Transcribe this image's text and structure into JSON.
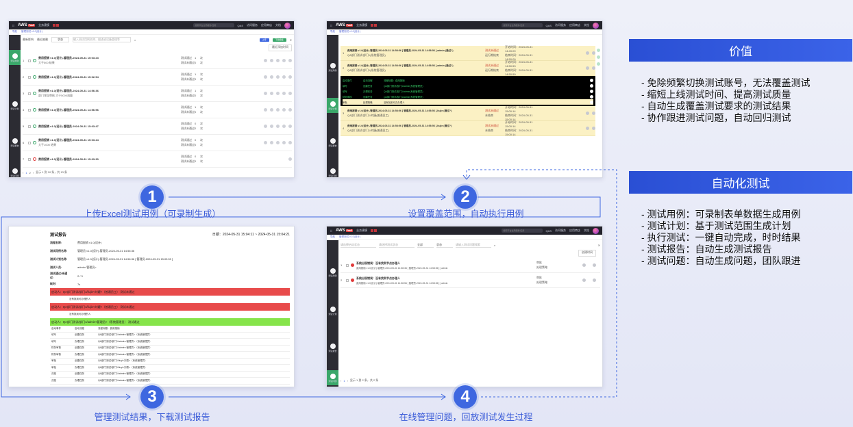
{
  "app": {
    "logo_text": "AWS",
    "logo_badge": "PaaS",
    "app_name": "业务建模",
    "nav": [
      "QAS",
      "访问服务",
      "应用商店",
      "文档"
    ],
    "search_placeholder": "搜索平台全局服务/应用"
  },
  "panel1": {
    "crumbs": [
      "导航",
      "管理测试 v1.0(设计)"
    ],
    "toolbar": {
      "checks": [
        "最新影响",
        "最近被删"
      ],
      "select": "状态",
      "search_placeholder": "输入测试用例名称、描述或设备管理等",
      "upload": "上传",
      "download": "下载模板"
    },
    "batch_label": "最近添加时间",
    "sidebar": [
      "测试用例",
      "测试计划",
      "测试报告",
      "测试问题"
    ],
    "rows": [
      {
        "n": "1",
        "title": "费用报销 v1.0(设计)-管理员-2024-05-31 15:03:23",
        "tag": "大于500 结果",
        "pass": "1",
        "fail": "0"
      },
      {
        "n": "2",
        "title": "费用报销 v1.0(设计)-管理员-2024-05-31 15:02:54",
        "tag": "",
        "pass": "1",
        "fail": "0"
      },
      {
        "n": "3",
        "title": "费用报销 v1.0(设计)-管理员-2024-05-31 14:56:36",
        "tag": "部门领导审核  大于5000流量",
        "pass": "1",
        "fail": "0"
      },
      {
        "n": "4",
        "title": "费用报销 v1.0(设计)-管理员-2024-05-31 14:56:56",
        "tag": "",
        "pass": "1",
        "fail": "0"
      },
      {
        "n": "5",
        "title": "费用报销 v1.0(设计)-管理员-2024-05-31 15:03:47",
        "tag": "",
        "pass": "0",
        "fail": "0"
      },
      {
        "n": "6",
        "title": "费用报销 v1.0(设计)-管理员-2024-05-31 15:03:44",
        "tag": "大于1000 结果",
        "pass": "0",
        "fail": "0"
      },
      {
        "n": "7",
        "title": "费用报销 v1.0(设计)-管理员-2024-05-31 15:03:30",
        "tag": "",
        "pass": "0",
        "fail": "0"
      }
    ],
    "pass_label": "测试通过",
    "fail_label": "测试未通过",
    "unit": "次",
    "pager": "显示 1 到 10 条，共 13 条"
  },
  "panel2": {
    "crumbs": [
      "导航",
      "管理测试 v1.0(设计)"
    ],
    "sidebar": [
      "测试用例",
      "测试计划",
      "测试报告",
      "测试问题"
    ],
    "rows": [
      {
        "n": "1",
        "title": "费用报销 v1.0(设计)-管理员-2024-05-31 14:58:56 [ 管理员-2024-05-31 14:58:56 ]-admin (通过?)",
        "sub": "QA部门测试/部门1(系统管理员)",
        "status1": "测试未通过",
        "status2": "运行期结束",
        "t1": "开始时间：2024-05-31 14:49:09",
        "t2": "结束时间：2024-05-31 14:50:09"
      },
      {
        "n": "2",
        "title": "费用报销 v1.0(设计)-管理员-2024-05-31 14:58:56 [ 管理员-2024-05-31 14:58:56 ]-admin (通过?)",
        "sub": "QA部门测试/部门1(系统管理员)",
        "status1": "测试未通过",
        "status2": "运行期结束",
        "t1": "开始时间：2024-05-31 14:50:53",
        "t2": "结束时间：2024-05-31 14:50:59"
      },
      {
        "n": "3",
        "title": "费用报销 v1.0(设计)-管理员-2024-05-31 14:58:56 [ 管理员-2024-05-31 14:58:56 ]-liujie (通过?)",
        "sub": "QA部门测试/部门1/刘婕(普通员工)",
        "status1": "测试未通过",
        "status2": "未结束",
        "t1": "开始时间：2024-05-31 15:00:14",
        "t2": "结束时间：2024-05-31 15:00:14"
      },
      {
        "n": "4",
        "title": "费用报销 v1.0(设计)-管理员-2024-05-31 14:58:56 [ 管理员-2024-05-31 14:58:56 ]-liujie (通过?)",
        "sub": "QA部门测试/部门1/刘婕(普通员工)",
        "status1": "测试未通过",
        "status2": "未结束",
        "t1": "开始时间：2024-05-31 15:00:14",
        "t2": "结束时间：2024-05-31 15:00:14"
      }
    ],
    "detail": [
      [
        "启动事件",
        "启动流程",
        "流程标题：费用报销"
      ],
      [
        "填写",
        "创建任务",
        "QA部门测试/部门1/admin(系统管理员)"
      ],
      [
        "填写",
        "办理任务",
        "QA部门测试/部门1/admin(系统管理员)"
      ],
      [
        "财务审核",
        "创建任务",
        "QA部门测试/部门1/admin(系统管理员)"
      ],
      [
        "审批",
        "处理策略",
        "没有找到可办办理人"
      ]
    ]
  },
  "panel3": {
    "title": "测试报告",
    "date": "日期：2024-05-31 15:04:11 ~ 2024-05-31 15:04:21",
    "kv": [
      {
        "k": "流程名称:",
        "v": "费用报销 v1.0(设计)"
      },
      {
        "k": "测试用例名称:",
        "v": "管理员 v1.0(设计)-管理员-2024-05-31 14:56:36"
      },
      {
        "k": "测试计划名称:",
        "v": "管理员 v1.0(设计)-管理员-2024-05-31 14:56:36 [ 管理员-2024-05-31 15:03:59 ]"
      },
      {
        "k": "测试人员:",
        "v": "admin<管理员>"
      },
      {
        "k": "测试通过/未通过:",
        "v": "2 / 3"
      },
      {
        "k": "耗时:",
        "v": "7s"
      }
    ],
    "bands": [
      {
        "text": "启动人：QA部门测试/部门1/liujie<刘婕>（普通员工）    测试未通过",
        "sub": "没有找到可办理的人"
      },
      {
        "text": "启动人：QA部门测试/部门1/liujie<刘婕>（普通员工）    测试未通过",
        "sub": "没有找到可办理的人"
      },
      {
        "text": "启动人：QA部门测试/部门1/admin<管理员>（系统管理员）    测试通过",
        "sub": ""
      }
    ],
    "grid": [
      [
        "启动事件",
        "启动流程",
        "流程标题：费用报销"
      ],
      [
        "填写",
        "创建任务",
        "QA部门测试/部门1/admin<管理员>（系统管理员）"
      ],
      [
        "填写",
        "办理任务",
        "QA部门测试/部门1/admin<管理员>（系统管理员）"
      ],
      [
        "财务审核",
        "创建任务",
        "QA部门测试/部门1/admin<管理员>（系统管理员）"
      ],
      [
        "财务审核",
        "办理任务",
        "QA部门测试/部门1/admin<管理员>（系统管理员）"
      ],
      [
        "审批",
        "创建任务",
        "QA部门测试/部门1/liuyi<刘易>（系统管理员）"
      ],
      [
        "审批",
        "办理任务",
        "QA部门测试/部门1/liuyi<刘易>（系统管理员）"
      ],
      [
        "归档",
        "创建任务",
        "QA部门测试/部门1/admin<管理员>（系统管理员）"
      ],
      [
        "归档",
        "办理任务",
        "QA部门测试/部门1/admin<管理员>（系统管理员）"
      ]
    ]
  },
  "panel4": {
    "crumbs": [
      "导航",
      "管理测试 v1.0(设计)"
    ],
    "sidebar": [
      "测试用例",
      "测试计划",
      "测试报告",
      "测试问题"
    ],
    "filters": [
      "请选择启动状态",
      "请选择测试状态",
      "全部",
      "状态",
      "请输入测试问题搜索"
    ],
    "sort_label": "创建时间",
    "rows": [
      {
        "n": "1",
        "title": "系统出现错误：没有找到节点办理人",
        "sub": "费用报销 v1.0(设计)-管理员-2024-05-31 14:58:36 [ 管理员-2024-05-31 14:58:56 ] | admin",
        "a": "审批",
        "b": "处理策略"
      },
      {
        "n": "2",
        "title": "系统出现错误：没有找到节点办理人",
        "sub": "费用报销 v1.0(设计)-管理员-2024-05-31 14:58:56 [ 管理员-2024-05-31 14:58:56 ] | admin",
        "a": "审批",
        "b": "处理策略"
      }
    ],
    "pager": "显示 1 到 2 条，共 2 条"
  },
  "steps": [
    {
      "num": "1",
      "caption": "上传Excel测试用例（可录制生成）"
    },
    {
      "num": "2",
      "caption": "设置覆盖范围，自动执行用例"
    },
    {
      "num": "3",
      "caption": "管理测试结果，下载测试报告"
    },
    {
      "num": "4",
      "caption": "在线管理问题，回放测试发生过程"
    }
  ],
  "cards": [
    {
      "title": "价值",
      "items": [
        "- 免除频繁切换测试账号，无法覆盖测试",
        "- 缩短上线测试时间、提高测试质量",
        "- 自动生成覆盖测试要求的测试结果",
        "- 协作跟进测试问题，自动回归测试"
      ]
    },
    {
      "title": "自动化测试",
      "items": [
        "- 测试用例：可录制表单数据生成用例",
        "- 测试计划：基于测试范围生成计划",
        "- 执行测试：一键自动完成，时时结果",
        "- 测试报告：自动生成测试报告",
        "- 测试问题：自动生成问题，团队跟进"
      ]
    }
  ],
  "colors": {
    "accent": "#3e67e0",
    "fail_band": "#e84b4b",
    "pass_band": "#86e44a",
    "highlight": "#fbf1c4"
  }
}
